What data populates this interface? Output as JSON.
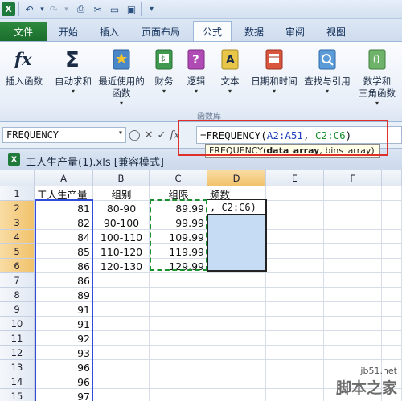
{
  "ribbon_tabs": [
    "文件",
    "开始",
    "插入",
    "页面布局",
    "公式",
    "数据",
    "审阅",
    "视图"
  ],
  "ribbon_buttons": [
    {
      "label": "插入函数",
      "icon": "fx-icon",
      "drop": ""
    },
    {
      "label": "自动求和",
      "icon": "sigma-icon",
      "drop": "▾"
    },
    {
      "label": "最近使用的\n函数",
      "icon": "star-book-icon",
      "drop": "▾"
    },
    {
      "label": "财务",
      "icon": "finance-book-icon",
      "drop": "▾"
    },
    {
      "label": "逻辑",
      "icon": "logic-book-icon",
      "drop": "▾"
    },
    {
      "label": "文本",
      "icon": "text-book-icon",
      "drop": "▾"
    },
    {
      "label": "日期和时间",
      "icon": "date-book-icon",
      "drop": "▾"
    },
    {
      "label": "查找与引用",
      "icon": "lookup-book-icon",
      "drop": "▾"
    },
    {
      "label": "数学和\n三角函数",
      "icon": "math-book-icon",
      "drop": "▾"
    }
  ],
  "group_label": "函数库",
  "name_box": "FREQUENCY",
  "formula": {
    "prefix": "=FREQUENCY(",
    "ref1": "A2:A51",
    "sep": ", ",
    "ref2": "C2:C6",
    "suffix": ")"
  },
  "tooltip": {
    "fn": "FREQUENCY(",
    "arg1": "data_array",
    "rest": ", bins_array)"
  },
  "workbook_title": "工人生产量(1).xls  [兼容模式]",
  "columns": [
    "A",
    "B",
    "C",
    "D",
    "E",
    "F"
  ],
  "rows": [
    "1",
    "2",
    "3",
    "4",
    "5",
    "6",
    "7",
    "8",
    "9",
    "10",
    "11",
    "12",
    "13",
    "14",
    "15"
  ],
  "cells": {
    "A1": "工人生产量",
    "B1": "组别",
    "C1": "组限",
    "D1": "频数",
    "A": [
      "81",
      "82",
      "84",
      "85",
      "86",
      "86",
      "89",
      "91",
      "91",
      "92",
      "93",
      "96",
      "96",
      "97"
    ],
    "B": [
      "80-90",
      "90-100",
      "100-110",
      "110-120",
      "120-130"
    ],
    "C": [
      "89.99",
      "99.99",
      "109.99",
      "119.99",
      "129.99"
    ],
    "D2": ", C2:C6)"
  },
  "watermark": {
    "url": "jb51.net",
    "name": "脚本之家"
  }
}
